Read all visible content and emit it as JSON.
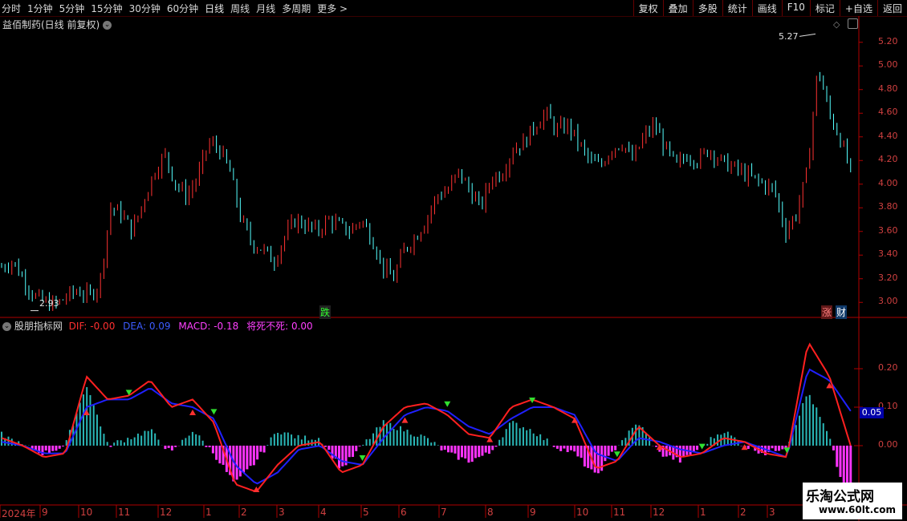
{
  "toolbar": {
    "periods": [
      "分时",
      "1分钟",
      "5分钟",
      "15分钟",
      "30分钟",
      "60分钟",
      "日线",
      "周线",
      "月线",
      "多周期",
      "更多 >"
    ],
    "active_period": "日线",
    "buttons": [
      "复权",
      "叠加",
      "多股",
      "统计",
      "画线",
      "F10",
      "标记",
      "+自选",
      "返回"
    ]
  },
  "main_panel": {
    "title": "益佰制药(日线 前复权)",
    "high_label": "5.27",
    "low_label": "2.93",
    "y_ticks": [
      "5.20",
      "5.00",
      "4.80",
      "4.60",
      "4.40",
      "4.20",
      "4.00",
      "3.80",
      "3.60",
      "3.40",
      "3.20",
      "3.00"
    ],
    "badge_die": "跌",
    "badge_zhang": "涨",
    "badge_cai": "财",
    "colors": {
      "up": "#ff3232",
      "down": "#54ffff",
      "axis": "#b00000"
    }
  },
  "indicator_panel": {
    "name": "股朋指标网",
    "dif_label": "DIF: -0.00",
    "dea_label": "DEA: 0.09",
    "macd_label": "MACD: -0.18",
    "extra_label": "将死不死: 0.00",
    "y_ticks": [
      "0.20",
      "0.10",
      "0.00"
    ],
    "current_marker": "0.05",
    "colors": {
      "dif": "#ff2020",
      "dea": "#2020ff",
      "macd_up": "#2ab7b7",
      "macd_down": "#ff33ff",
      "marker_bg": "#0000aa"
    }
  },
  "x_axis": {
    "labels": [
      "2024年",
      "9",
      "10",
      "11",
      "12",
      "1",
      "2",
      "3",
      "4",
      "5",
      "6",
      "7",
      "8",
      "9",
      "10",
      "11",
      "12",
      "1",
      "2",
      "3"
    ]
  },
  "watermark": {
    "title": "乐淘公式网",
    "url": "www.60lt.com"
  },
  "chart_data": [
    {
      "type": "candlestick",
      "title": "益佰制药(日线 前复权)",
      "ylim": [
        2.9,
        5.3
      ],
      "y_ticks": [
        5.2,
        5.0,
        4.8,
        4.6,
        4.4,
        4.2,
        4.0,
        3.8,
        3.6,
        3.4,
        3.2,
        3.0
      ],
      "x_labels": [
        "2024年",
        "9",
        "10",
        "11",
        "12",
        "1",
        "2",
        "3",
        "4",
        "5",
        "6",
        "7",
        "8",
        "9",
        "10",
        "11",
        "12",
        "1",
        "2",
        "3"
      ],
      "close_path_approx": [
        3.3,
        3.35,
        3.2,
        3.05,
        3.0,
        2.98,
        3.05,
        3.1,
        3.05,
        3.15,
        3.8,
        3.75,
        3.6,
        3.85,
        4.1,
        4.25,
        4.0,
        3.9,
        4.05,
        4.35,
        4.3,
        4.1,
        3.7,
        3.5,
        3.45,
        3.35,
        3.55,
        3.7,
        3.65,
        3.6,
        3.7,
        3.65,
        3.6,
        3.7,
        3.55,
        3.3,
        3.2,
        3.45,
        3.55,
        3.7,
        3.9,
        3.95,
        4.1,
        3.95,
        3.8,
        4.05,
        4.1,
        4.3,
        4.35,
        4.5,
        4.6,
        4.45,
        4.5,
        4.35,
        4.2,
        4.15,
        4.3,
        4.35,
        4.2,
        4.4,
        4.5,
        4.3,
        4.15,
        4.25,
        4.2,
        4.3,
        4.2,
        4.15,
        4.1,
        4.05,
        4.0,
        3.95,
        3.6,
        3.75,
        4.1,
        5.0,
        4.6,
        4.4,
        4.1
      ],
      "annotations": {
        "high": 5.27,
        "low": 2.93
      }
    },
    {
      "type": "bar",
      "title": "股朋指标网",
      "ylim": [
        -0.15,
        0.3
      ],
      "y_ticks": [
        0.2,
        0.1,
        0.0
      ],
      "series": [
        {
          "name": "DIF",
          "values": [
            0.02,
            0.0,
            -0.03,
            -0.02,
            0.18,
            0.12,
            0.13,
            0.17,
            0.1,
            0.12,
            0.06,
            -0.1,
            -0.12,
            -0.05,
            0.0,
            0.01,
            -0.07,
            -0.05,
            0.05,
            0.1,
            0.11,
            0.08,
            0.03,
            0.02,
            0.1,
            0.12,
            0.1,
            0.07,
            -0.06,
            -0.04,
            0.05,
            0.0,
            -0.03,
            -0.02,
            0.02,
            0.01,
            -0.02,
            -0.03,
            0.27,
            0.18,
            -0.0
          ]
        },
        {
          "name": "DEA",
          "values": [
            0.01,
            0.0,
            -0.02,
            -0.02,
            0.1,
            0.12,
            0.12,
            0.15,
            0.11,
            0.1,
            0.07,
            -0.05,
            -0.1,
            -0.07,
            -0.01,
            0.0,
            -0.04,
            -0.05,
            0.02,
            0.08,
            0.1,
            0.09,
            0.05,
            0.03,
            0.07,
            0.1,
            0.1,
            0.08,
            -0.02,
            -0.04,
            0.02,
            0.01,
            -0.01,
            -0.02,
            0.0,
            0.01,
            -0.01,
            -0.03,
            0.2,
            0.17,
            0.09
          ]
        },
        {
          "name": "MACD",
          "values": [
            0.03,
            0.0,
            -0.02,
            0.0,
            0.16,
            0.0,
            0.02,
            0.04,
            -0.02,
            0.04,
            -0.02,
            -0.1,
            -0.04,
            0.04,
            0.02,
            0.02,
            -0.06,
            0.0,
            0.06,
            0.04,
            0.02,
            -0.02,
            -0.04,
            -0.02,
            0.06,
            0.04,
            0.0,
            -0.02,
            -0.08,
            0.0,
            0.06,
            -0.02,
            -0.04,
            0.0,
            0.04,
            0.0,
            -0.02,
            0.0,
            0.14,
            0.02,
            -0.18
          ]
        }
      ],
      "current_values": {
        "DIF": -0.0,
        "DEA": 0.09,
        "MACD": -0.18,
        "将死不死": 0.0
      }
    }
  ]
}
